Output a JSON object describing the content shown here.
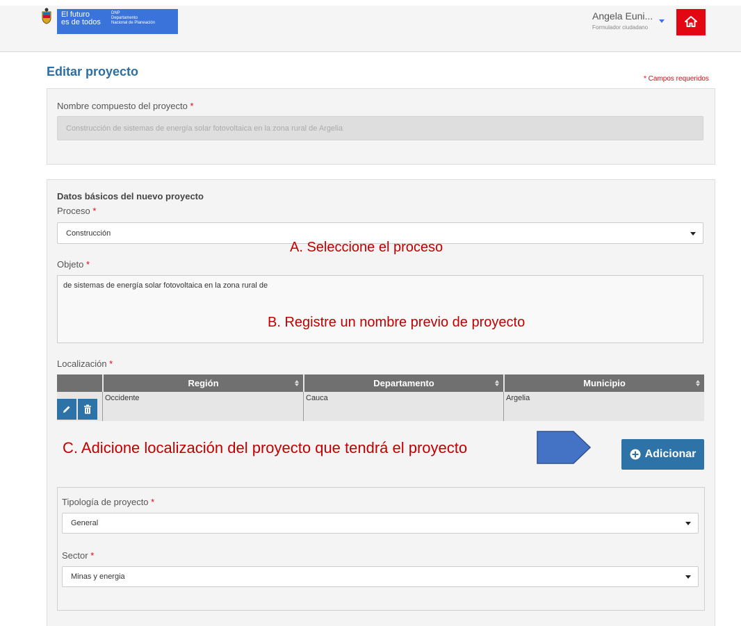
{
  "header": {
    "brand_line1": "El futuro",
    "brand_line2": "es de todos",
    "brand_sub1": "DNP",
    "brand_sub2": "Departamento",
    "brand_sub3": "Nacional de Planeación",
    "user_name": "Angela Euni...",
    "user_role": "Formulador ciudadano"
  },
  "page": {
    "title": "Editar proyecto",
    "required_note": "* Campos requeridos"
  },
  "composite_name": {
    "label": "Nombre compuesto del proyecto",
    "value": "Construcción de sistemas de energía solar fotovoltaica en la zona rural de  Argelia"
  },
  "basic_data": {
    "section_title": "Datos básicos del nuevo proyecto",
    "process_label": "Proceso",
    "process_value": "Construcción",
    "object_label": "Objeto",
    "object_value": "de sistemas de energía solar fotovoltaica en la zona rural de"
  },
  "annotations": {
    "a": "A. Seleccione el proceso",
    "b": "B. Registre un nombre previo de proyecto",
    "c": "C. Adicione localización del proyecto que tendrá el proyecto"
  },
  "location": {
    "label": "Localización",
    "columns": [
      "Región",
      "Departamento",
      "Municipio"
    ],
    "rows": [
      {
        "region": "Occidente",
        "departamento": "Cauca",
        "municipio": "Argelia"
      }
    ],
    "add_label": "Adicionar"
  },
  "typology": {
    "label": "Tipología de proyecto",
    "value": "General"
  },
  "sector": {
    "label": "Sector",
    "value": "Minas y energia"
  },
  "colors": {
    "accent": "#2e73a8",
    "brand": "#3a73d9",
    "required": "#e30613",
    "annotation": "#c00000",
    "arrow": "#4472c4"
  }
}
